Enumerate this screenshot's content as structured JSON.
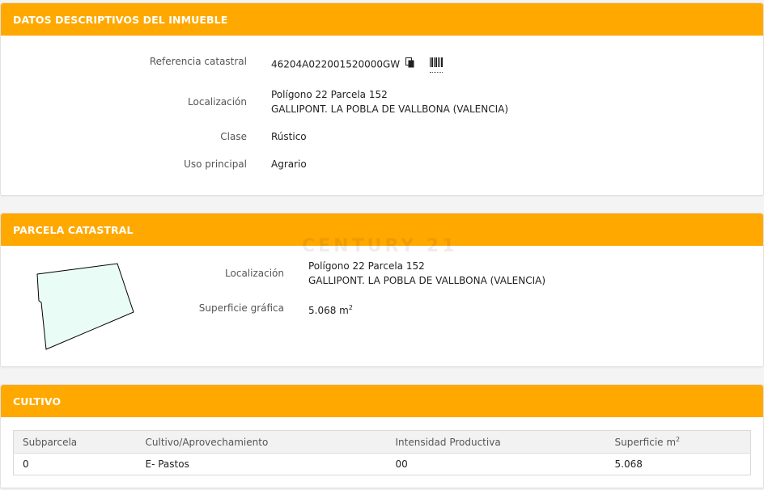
{
  "section1": {
    "title": "DATOS DESCRIPTIVOS DEL INMUEBLE",
    "fields": {
      "referencia_label": "Referencia catastral",
      "referencia_value": "46204A022001520000GW",
      "localizacion_label": "Localización",
      "localizacion_line1": "Polígono 22 Parcela 152",
      "localizacion_line2": "GALLIPONT. LA POBLA DE VALLBONA (VALENCIA)",
      "clase_label": "Clase",
      "clase_value": "Rústico",
      "uso_label": "Uso principal",
      "uso_value": "Agrario"
    },
    "icons": [
      "copy-icon",
      "barcode-icon"
    ]
  },
  "section2": {
    "title": "PARCELA CATASTRAL",
    "watermark": "CENTURY 21",
    "localizacion_label": "Localización",
    "localizacion_line1": "Polígono 22 Parcela 152",
    "localizacion_line2": "GALLIPONT. LA POBLA DE VALLBONA (VALENCIA)",
    "superficie_label": "Superficie gráfica",
    "superficie_value": "5.068 m",
    "superficie_unit_sup": "2"
  },
  "section3": {
    "title": "CULTIVO",
    "columns": [
      "Subparcela",
      "Cultivo/Aprovechamiento",
      "Intensidad Productiva",
      "Superficie m"
    ],
    "col4_sup": "2",
    "rows": [
      [
        "0",
        "E- Pastos",
        "00",
        "5.068"
      ]
    ]
  },
  "colors": {
    "header": "#ffa800",
    "parcel_fill": "#eafcf6",
    "parcel_stroke": "#000000"
  }
}
